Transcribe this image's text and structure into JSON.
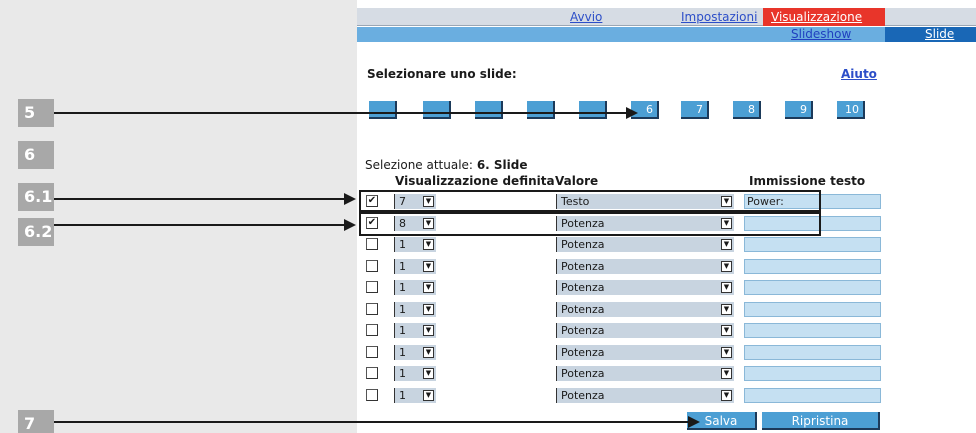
{
  "callouts": [
    "5",
    "6",
    "6.1",
    "6.2",
    "7"
  ],
  "tabs": {
    "start": "Avvio",
    "settings": "Impostazioni",
    "display": "Visualizzazione"
  },
  "subtabs": {
    "slideshow": "Slideshow",
    "slide": "Slide"
  },
  "select_slide_label": "Selezionare uno slide:",
  "help_link": "Aiuto",
  "slide_buttons": [
    "",
    "",
    "",
    "",
    "",
    "6",
    "7",
    "8",
    "9",
    "10"
  ],
  "current_selection": {
    "prefix": "Selezione attuale:",
    "value": "6. Slide"
  },
  "table": {
    "headers": {
      "display": "Visualizzazione definita",
      "value": "Valore",
      "text_input": "Immissione testo"
    },
    "rows": [
      {
        "checked": true,
        "num": "7",
        "value": "Testo",
        "text": "Power:"
      },
      {
        "checked": true,
        "num": "8",
        "value": "Potenza",
        "text": ""
      },
      {
        "checked": false,
        "num": "1",
        "value": "Potenza",
        "text": ""
      },
      {
        "checked": false,
        "num": "1",
        "value": "Potenza",
        "text": ""
      },
      {
        "checked": false,
        "num": "1",
        "value": "Potenza",
        "text": ""
      },
      {
        "checked": false,
        "num": "1",
        "value": "Potenza",
        "text": ""
      },
      {
        "checked": false,
        "num": "1",
        "value": "Potenza",
        "text": ""
      },
      {
        "checked": false,
        "num": "1",
        "value": "Potenza",
        "text": ""
      },
      {
        "checked": false,
        "num": "1",
        "value": "Potenza",
        "text": ""
      },
      {
        "checked": false,
        "num": "1",
        "value": "Potenza",
        "text": ""
      }
    ]
  },
  "buttons": {
    "save": "Salva",
    "reset": "Ripristina"
  },
  "colors": {
    "active_tab": "#e8352a",
    "button_blue": "#4c9fd4",
    "subbar": "#6aaee0",
    "input_fill": "#c5e0f2"
  },
  "icons": {
    "dropdown": "chevron-down-icon",
    "checkbox": "checkbox-icon"
  }
}
